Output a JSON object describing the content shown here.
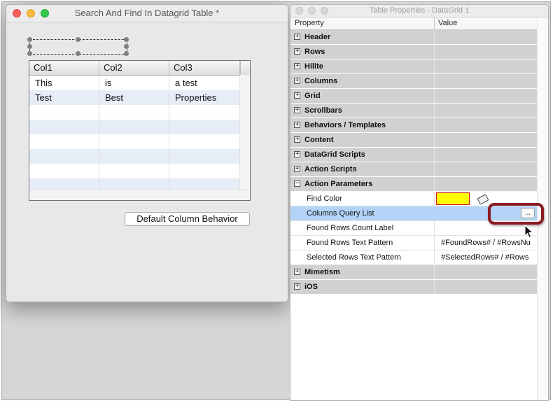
{
  "window_left": {
    "title": "Search And Find In Datagrid Table *",
    "datagrid": {
      "columns": [
        "Col1",
        "Col2",
        "Col3"
      ],
      "rows": [
        [
          "This",
          "is",
          "a test"
        ],
        [
          "Test",
          "Best",
          "Properties"
        ]
      ]
    },
    "default_column_button": "Default Column Behavior"
  },
  "window_right": {
    "title": "Table Properties - DataGrid 1",
    "header": {
      "property": "Property",
      "value": "Value"
    },
    "sections_before": [
      "Header",
      "Rows",
      "Hilite",
      "Columns",
      "Grid",
      "Scrollbars",
      "Behaviors / Templates",
      "Content",
      "DataGrid Scripts",
      "Action Scripts"
    ],
    "expanded_section": "Action Parameters",
    "expander_collapsed": "+",
    "expander_expanded": "−",
    "params": {
      "find_color": {
        "label": "Find Color",
        "color": "#ffff00"
      },
      "columns_query_list": {
        "label": "Columns Query List",
        "button": "..."
      },
      "found_rows_count_label": {
        "label": "Found Rows Count Label",
        "value": ""
      },
      "found_rows_text_pattern": {
        "label": "Found Rows Text Pattern",
        "value": "#FoundRows# / #RowsNu"
      },
      "selected_rows_text_pattern": {
        "label": "Selected Rows Text Pattern",
        "value": "#SelectedRows# / #Rows"
      }
    },
    "sections_after": [
      "Mimetism",
      "iOS"
    ]
  },
  "colors": {
    "highlight_ring": "#8a1a24",
    "selected_row": "#b3d4f7",
    "section_row": "#d1d1d1",
    "alt_grid_row": "#e6edf6"
  }
}
